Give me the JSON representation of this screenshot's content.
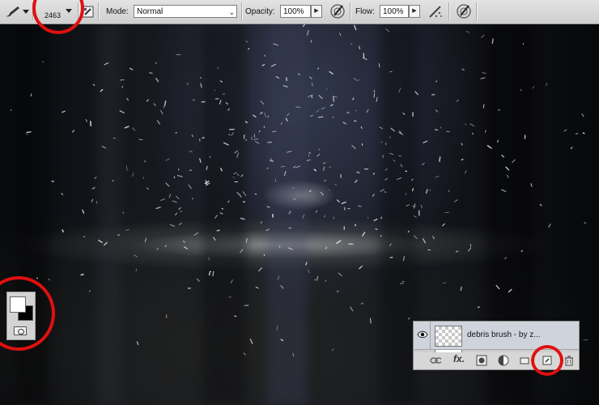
{
  "options_bar": {
    "brush_size": "2463",
    "mode_label": "Mode:",
    "mode_value": "Normal",
    "opacity_label": "Opacity:",
    "opacity_value": "100%",
    "flow_label": "Flow:",
    "flow_value": "100%",
    "icons": [
      "brush-tool-icon",
      "brush-preset-dropdown-icon",
      "brush-panel-toggle-icon",
      "pressure-opacity-icon",
      "airbrush-icon",
      "pressure-size-icon"
    ]
  },
  "layers_panel": {
    "layer_name": "debris brush - by z...",
    "footer_icons": [
      "link-layers-icon",
      "fx-icon",
      "add-mask-icon",
      "adjustment-layer-icon",
      "new-group-icon",
      "new-layer-icon",
      "trash-icon"
    ]
  },
  "swatches": {
    "foreground_color": "#ffffff",
    "background_color": "#000000"
  },
  "annotation_color": "#e01010"
}
